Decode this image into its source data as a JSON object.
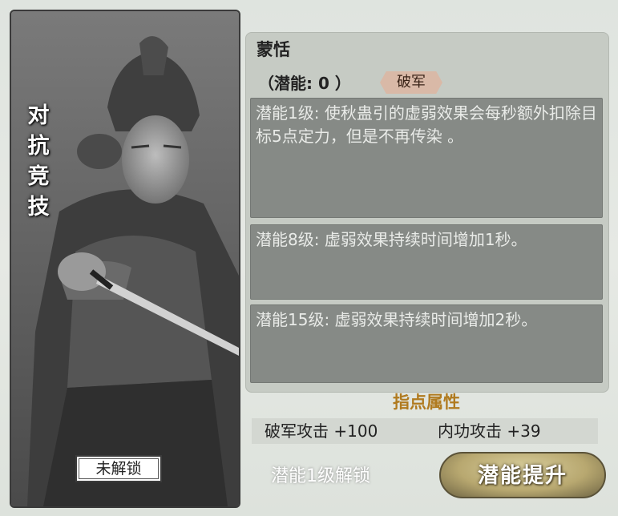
{
  "card": {
    "title_chars": [
      "对",
      "抗",
      "竞",
      "技"
    ],
    "lock_status": "未解锁"
  },
  "hero": {
    "name": "蒙恬",
    "potential_label": "（潜能: 0 ）",
    "faction_tag": "破军"
  },
  "tiers": [
    {
      "text": "潜能1级: 使秋蛊引的虚弱效果会每秒额外扣除目标5点定力，但是不再传染 。"
    },
    {
      "text": "潜能8级: 虚弱效果持续时间增加1秒。"
    },
    {
      "text": "潜能15级: 虚弱效果持续时间增加2秒。"
    }
  ],
  "attributes": {
    "title": "指点属性",
    "items": [
      {
        "label": "破军攻击 +100"
      },
      {
        "label": "内功攻击 +39"
      }
    ]
  },
  "footer": {
    "unlock_text": "潜能1级解锁",
    "upgrade_label": "潜能提升"
  },
  "colors": {
    "accent_gold": "#b07a1f",
    "panel_bg": "#c6cbc4",
    "tier_box_bg": "#868a86"
  }
}
